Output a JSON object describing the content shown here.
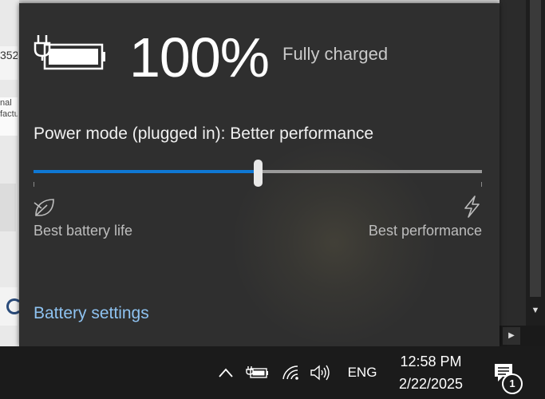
{
  "background": {
    "fragment_top": "352",
    "fragment_mid": "nal\nfactu"
  },
  "flyout": {
    "percent": "100%",
    "charge_status": "Fully charged",
    "power_mode_label": "Power mode (plugged in): Better performance",
    "slider": {
      "position_fraction": 0.5
    },
    "left_label": "Best battery life",
    "right_label": "Best performance",
    "settings_link": "Battery settings",
    "accent_color": "#0f78d4"
  },
  "taskbar": {
    "language": "ENG",
    "time": "12:58 PM",
    "date": "2/22/2025",
    "notification_count": "1",
    "icons": [
      "chevron-up-icon",
      "battery-plug-icon",
      "wifi-icon",
      "volume-icon",
      "notification-icon"
    ]
  }
}
